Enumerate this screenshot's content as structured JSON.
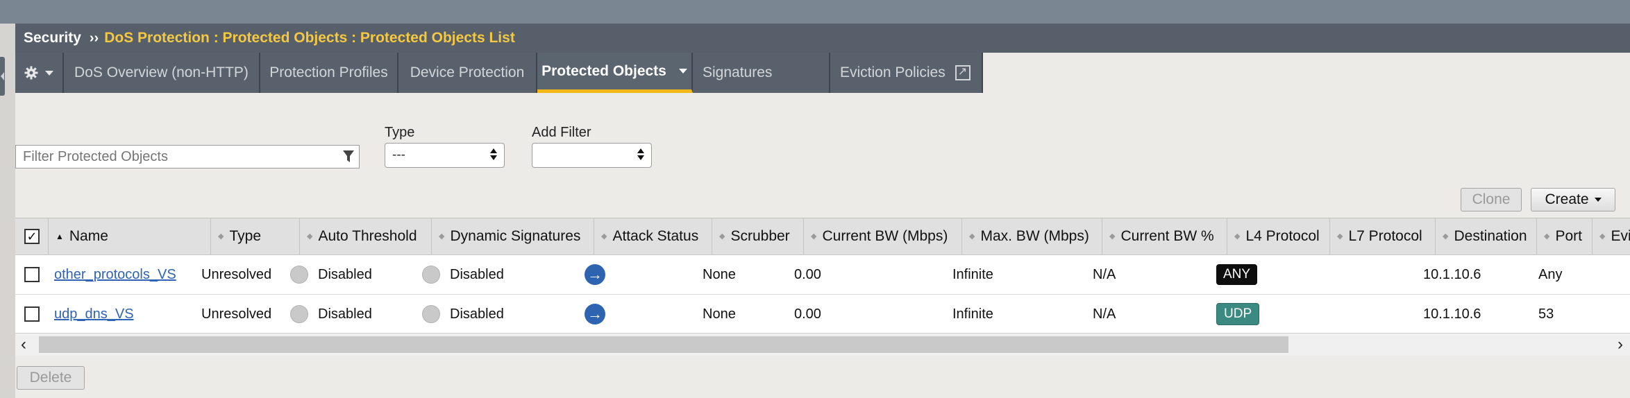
{
  "breadcrumb": {
    "section": "Security",
    "separator": "››",
    "path": "DoS Protection : Protected Objects : Protected Objects List"
  },
  "tabs": [
    {
      "label": "DoS Overview (non-HTTP)"
    },
    {
      "label": "Protection Profiles"
    },
    {
      "label": "Device Protection"
    },
    {
      "label": "Protected Objects"
    },
    {
      "label": "Signatures"
    },
    {
      "label": "Eviction Policies"
    }
  ],
  "filters": {
    "search_placeholder": "Filter Protected Objects",
    "type_label": "Type",
    "type_value": "---",
    "add_filter_label": "Add Filter",
    "add_filter_value": ""
  },
  "actions": {
    "clone": "Clone",
    "create": "Create",
    "delete": "Delete"
  },
  "table": {
    "columns": [
      "Name",
      "Type",
      "Auto Threshold",
      "Dynamic Signatures",
      "Attack Status",
      "Scrubber",
      "Current BW (Mbps)",
      "Max. BW (Mbps)",
      "Current BW %",
      "L4 Protocol",
      "L7 Protocol",
      "Destination",
      "Port",
      "Evic"
    ],
    "rows": [
      {
        "name": "other_protocols_VS",
        "type": "Unresolved",
        "auto_threshold": "Disabled",
        "dynamic_signatures": "Disabled",
        "scrubber": "None",
        "current_bw": "0.00",
        "max_bw": "Infinite",
        "current_bw_pct": "N/A",
        "l4": "ANY",
        "l7": "",
        "destination": "10.1.10.6",
        "port": "Any"
      },
      {
        "name": "udp_dns_VS",
        "type": "Unresolved",
        "auto_threshold": "Disabled",
        "dynamic_signatures": "Disabled",
        "scrubber": "None",
        "current_bw": "0.00",
        "max_bw": "Infinite",
        "current_bw_pct": "N/A",
        "l4": "UDP",
        "l7": "",
        "destination": "10.1.10.6",
        "port": "53"
      }
    ]
  },
  "colors": {
    "accent": "#f3b817",
    "titlebar": "#57606a",
    "tabbar": "#59626c",
    "link": "#2f63b5",
    "attack_icon": "#2d63b0",
    "badge_any": "#0e0e0e",
    "badge_udp": "#3a8a82"
  }
}
